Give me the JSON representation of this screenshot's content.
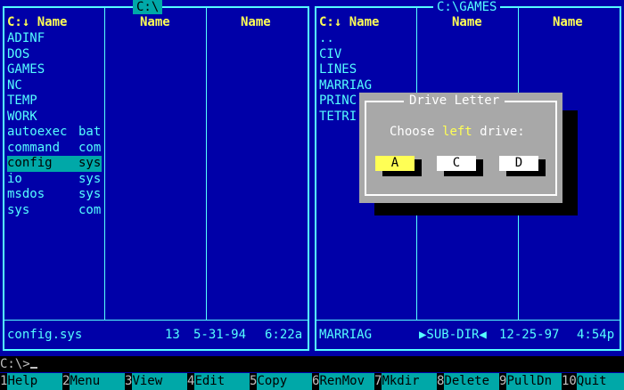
{
  "left_panel": {
    "title": "C:\\",
    "columns": [
      "C:↓ Name",
      "Name",
      "Name"
    ],
    "files": [
      {
        "name": "ADINF",
        "ext": ""
      },
      {
        "name": "DOS",
        "ext": ""
      },
      {
        "name": "GAMES",
        "ext": ""
      },
      {
        "name": "NC",
        "ext": ""
      },
      {
        "name": "TEMP",
        "ext": ""
      },
      {
        "name": "WORK",
        "ext": ""
      },
      {
        "name": "autoexec",
        "ext": "bat"
      },
      {
        "name": "command",
        "ext": "com"
      },
      {
        "name": "config",
        "ext": "sys"
      },
      {
        "name": "io",
        "ext": "sys"
      },
      {
        "name": "msdos",
        "ext": "sys"
      },
      {
        "name": "sys",
        "ext": "com"
      }
    ],
    "status": {
      "name": "config.sys",
      "size": "13",
      "date": "5-31-94",
      "time": "6:22a"
    }
  },
  "right_panel": {
    "title": "C:\\GAMES",
    "columns": [
      "C:↓ Name",
      "Name",
      "Name"
    ],
    "files": [
      {
        "name": "..",
        "ext": ""
      },
      {
        "name": "CIV",
        "ext": ""
      },
      {
        "name": "LINES",
        "ext": ""
      },
      {
        "name": "MARRIAG",
        "ext": ""
      },
      {
        "name": "PRINC",
        "ext": ""
      },
      {
        "name": "TETRI",
        "ext": ""
      }
    ],
    "status": {
      "name": "MARRIAG",
      "size": "▶SUB-DIR◀",
      "date": "12-25-97",
      "time": "4:54p"
    }
  },
  "dialog": {
    "title": "Drive Letter",
    "prompt_before": "Choose ",
    "prompt_highlight": "left",
    "prompt_after": " drive:",
    "drives": [
      "A",
      "C",
      "D"
    ],
    "selected_drive": "A"
  },
  "command_line": {
    "prompt": "C:\\>"
  },
  "keybar": [
    {
      "num": "1",
      "label": "Help"
    },
    {
      "num": "2",
      "label": "Menu"
    },
    {
      "num": "3",
      "label": "View"
    },
    {
      "num": "4",
      "label": "Edit"
    },
    {
      "num": "5",
      "label": "Copy"
    },
    {
      "num": "6",
      "label": "RenMov"
    },
    {
      "num": "7",
      "label": "Mkdir"
    },
    {
      "num": "8",
      "label": "Delete"
    },
    {
      "num": "9",
      "label": "PullDn"
    },
    {
      "num": "10",
      "label": "Quit"
    }
  ],
  "colors": {
    "background": "#0000a8",
    "frame": "#55ffff",
    "header": "#ffff55",
    "highlight": "#00a8a8",
    "dialog": "#a8a8a8"
  }
}
